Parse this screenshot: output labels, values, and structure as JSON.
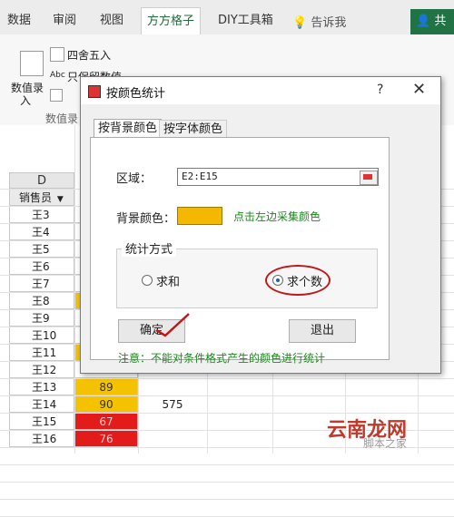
{
  "ribbon": {
    "tabs": [
      "数据",
      "审阅",
      "视图",
      "方方格子",
      "DIY工具箱"
    ],
    "active_tab": "方方格子",
    "tell_me": "告诉我",
    "share": "共享",
    "items": {
      "round": "四舍五入",
      "keep_value": "只保留数值",
      "value_entry": "数值录",
      "value_entry_sub": "入",
      "group_label": "数值录"
    }
  },
  "sheet": {
    "column_header": "D",
    "header_cell": "销售员",
    "rows": [
      {
        "name": "王3",
        "value": "",
        "color": "#ffffff"
      },
      {
        "name": "王4",
        "value": "",
        "color": "#ffffff"
      },
      {
        "name": "王5",
        "value": "",
        "color": "#ffffff"
      },
      {
        "name": "王6",
        "value": "",
        "color": "#ffffff"
      },
      {
        "name": "王7",
        "value": "",
        "color": "#ffffff"
      },
      {
        "name": "王8",
        "value": "",
        "color": "#f5c200"
      },
      {
        "name": "王9",
        "value": "",
        "color": "#ffffff"
      },
      {
        "name": "王10",
        "value": "",
        "color": "#ffffff"
      },
      {
        "name": "王11",
        "value": "",
        "color": "#f5c200"
      },
      {
        "name": "王12",
        "value": "",
        "color": "#ffffff"
      },
      {
        "name": "王13",
        "value": "89",
        "color": "#f5c200"
      },
      {
        "name": "王14",
        "value": "90",
        "color": "#f5c200"
      },
      {
        "name": "王15",
        "value": "67",
        "color": "#e41b1b"
      },
      {
        "name": "王16",
        "value": "76",
        "color": "#e41b1b"
      }
    ],
    "result_value": "575"
  },
  "dialog": {
    "title": "按颜色统计",
    "help": "?",
    "close": "✕",
    "tabs": [
      "按背景颜色",
      "按字体颜色"
    ],
    "range_label": "区域：",
    "range_value": "E2:E15",
    "bg_color_label": "背景颜色：",
    "bg_color": "#f5b800",
    "pick_hint": "点击左边采集颜色",
    "method_label": "统计方式",
    "option_sum": "求和",
    "option_count": "求个数",
    "ok": "确定",
    "exit": "退出",
    "note": "注意：不能对条件格式产生的颜色进行统计"
  },
  "watermark": {
    "text": "云南龙网",
    "sub": "脚本之家"
  }
}
